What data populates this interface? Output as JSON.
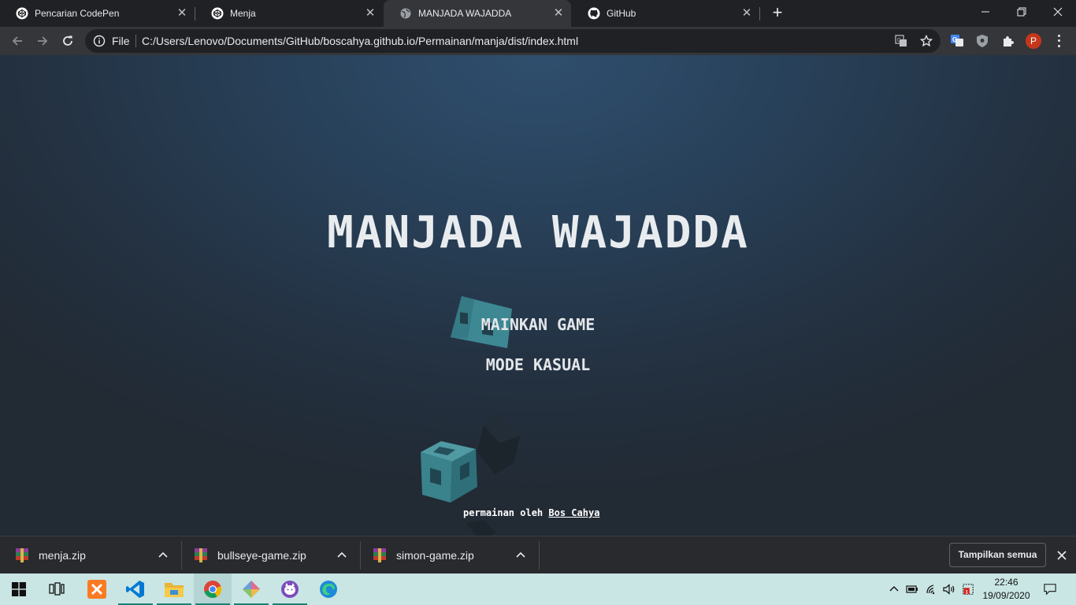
{
  "tabs": [
    {
      "title": "Pencarian CodePen",
      "favicon": "codepen-icon",
      "active": false
    },
    {
      "title": "Menja",
      "favicon": "codepen-icon",
      "active": false
    },
    {
      "title": "MANJADA WAJADDA",
      "favicon": "globe-icon",
      "active": true
    },
    {
      "title": "GitHub",
      "favicon": "github-icon",
      "active": false
    }
  ],
  "address_bar": {
    "scheme_label": "File",
    "url": "C:/Users/Lenovo/Documents/GitHub/boscahya.github.io/Permainan/manja/dist/index.html"
  },
  "profile": {
    "initial": "P",
    "color": "#c5361b"
  },
  "game": {
    "title": "MANJADA WAJADDA",
    "menu": [
      "MAINKAN GAME",
      "MODE KASUAL"
    ],
    "credit_prefix": "permainan oleh",
    "credit_author": "Bos Cahya"
  },
  "downloads": {
    "items": [
      "menja.zip",
      "bullseye-game.zip",
      "simon-game.zip"
    ],
    "show_all_label": "Tampilkan semua"
  },
  "taskbar": {
    "time": "22:46",
    "date": "19/09/2020",
    "notification_badge": "1"
  },
  "colors": {
    "cube_teal": "#3f8f99",
    "cube_dark": "#1f2a35",
    "page_top": "#2f4f6e",
    "page_bottom": "#222a34"
  }
}
